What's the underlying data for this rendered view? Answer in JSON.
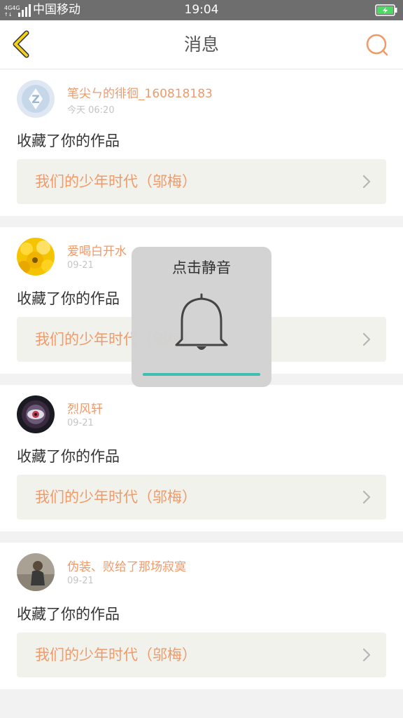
{
  "status_bar": {
    "network": "4G 4G",
    "carrier": "中国移动",
    "time": "19:04"
  },
  "header": {
    "title": "消息",
    "back_icon": "chevron-left-icon",
    "search_icon": "search-icon"
  },
  "messages": [
    {
      "user": "笔尖ㄣ的徘徊_160818183",
      "time": "今天 06:20",
      "action": "收藏了你的作品",
      "work": "我们的少年时代（邬梅）"
    },
    {
      "user": "爱喝白开水",
      "time": "09-21",
      "action": "收藏了你的作品",
      "work": "我们的少年时代（邬梅）"
    },
    {
      "user": "烈风轩",
      "time": "09-21",
      "action": "收藏了你的作品",
      "work": "我们的少年时代（邬梅）"
    },
    {
      "user": "伪装、败给了那场寂寞",
      "time": "09-21",
      "action": "收藏了你的作品",
      "work": "我们的少年时代（邬梅）"
    }
  ],
  "toast": {
    "text": "点击静音",
    "icon": "bell-icon",
    "progress": 1.0
  },
  "colors": {
    "accent_orange": "#ef9a6a",
    "back_yellow": "#e6c200",
    "progress_teal": "#3cbfb0",
    "battery_green": "#4cd964"
  }
}
